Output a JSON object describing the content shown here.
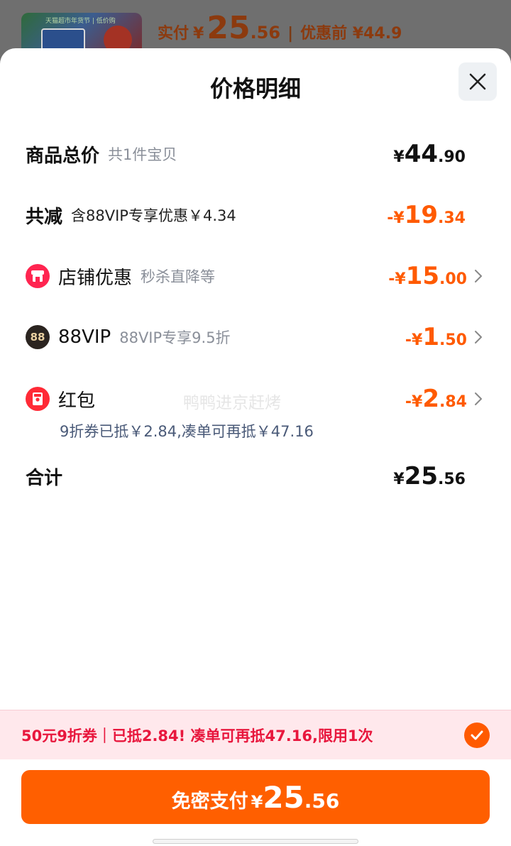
{
  "background": {
    "thumb_label": "天猫超市年货节 | 低价购",
    "price_label": "实付",
    "price_yen": "¥",
    "price_int": "25",
    "price_dec": ".56",
    "separator": "|",
    "before_label": "优惠前 ¥44.9"
  },
  "sheet": {
    "title": "价格明细",
    "close_icon": "close-icon"
  },
  "rows": {
    "total": {
      "name": "商品总价",
      "sub": "共1件宝贝",
      "yen": "¥",
      "int": "44",
      "dec": ".90"
    },
    "reduce": {
      "name": "共减",
      "sub": "含88VIP专享优惠￥4.34",
      "yen": "-¥",
      "int": "19",
      "dec": ".34"
    },
    "shop": {
      "icon": "shop-icon",
      "name": "店铺优惠",
      "sub": "秒杀直降等",
      "yen": "-¥",
      "int": "15",
      "dec": ".00"
    },
    "vip": {
      "icon": "88vip-icon",
      "icon_text": "88",
      "name": "88VIP",
      "sub": "88VIP专享9.5折",
      "yen": "-¥",
      "int": "1",
      "dec": ".50"
    },
    "redpacket": {
      "icon": "red-packet-icon",
      "name": "红包",
      "yen": "-¥",
      "int": "2",
      "dec": ".84",
      "note": "9折券已抵￥2.84,凑单可再抵￥47.16"
    },
    "sum": {
      "name": "合计",
      "yen": "¥",
      "int": "25",
      "dec": ".56"
    }
  },
  "watermark": "鸭鸭进京赶烤",
  "promo": {
    "text": "50元9折券｜已抵2.84! 凑单可再抵47.16,限用1次",
    "check_icon": "check-icon"
  },
  "pay_button": {
    "label": "免密支付",
    "yen": "¥",
    "int": "25",
    "dec": ".56"
  },
  "colors": {
    "accent": "#ff5f00",
    "discount": "#ff5a00",
    "promo_text": "#e8173d",
    "promo_bg": "#ffe8ec"
  }
}
